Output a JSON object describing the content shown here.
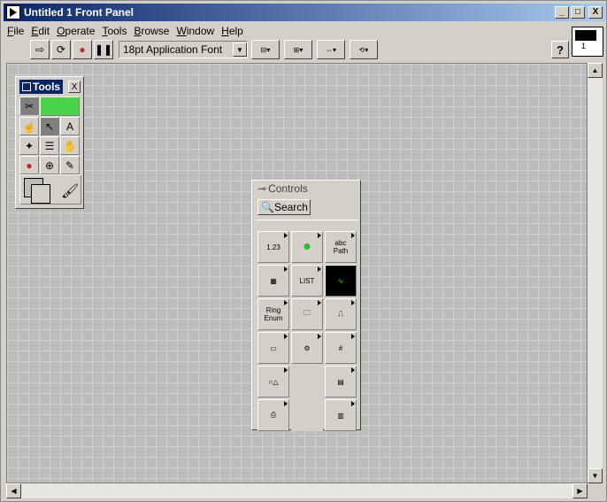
{
  "window": {
    "title": "Untitled 1 Front Panel",
    "min_label": "_",
    "max_label": "□",
    "close_label": "X"
  },
  "menu": [
    "File",
    "Edit",
    "Operate",
    "Tools",
    "Browse",
    "Window",
    "Help"
  ],
  "toolbar": {
    "font_value": "18pt Application Font",
    "help_label": "?",
    "connector_label": "1"
  },
  "tools_palette": {
    "title": "Tools",
    "close_label": "X"
  },
  "controls_palette": {
    "title": "Controls",
    "search_label": "Search",
    "labels": {
      "numeric": "1.23",
      "string_top": "abc",
      "string_bottom": "Path",
      "list": "LIST",
      "ring": "Ring",
      "enum": "Enum"
    }
  }
}
